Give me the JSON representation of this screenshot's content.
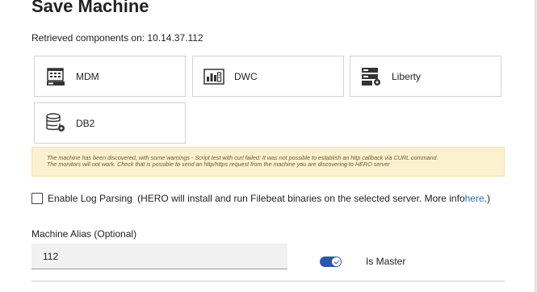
{
  "page": {
    "title": "Save Machine",
    "retrieved_text": "Retrieved components on: 10.14.37.112"
  },
  "components": [
    {
      "label": "MDM",
      "icon": "calendar-server-icon"
    },
    {
      "label": "DWC",
      "icon": "dashboard-chart-icon"
    },
    {
      "label": "Liberty",
      "icon": "server-gear-icon"
    },
    {
      "label": "DB2",
      "icon": "database-gear-icon"
    }
  ],
  "warning": {
    "line1": "The machine has been discovered, with some warnings - Script test with curl failed: It was not possible to establish an http callback via CURL command.",
    "line2": "The monitors will not work. Check that is possible to send an http/https request from the machine you are discovering to HERO server"
  },
  "log_parsing": {
    "label": "Enable Log Parsing",
    "note": "(HERO will install and run Filebeat binaries on the selected server. More info ",
    "link": "here",
    "note_end": ".)",
    "checked": false
  },
  "alias": {
    "label": "Machine Alias (Optional)",
    "value": "112"
  },
  "master": {
    "label": "Is Master",
    "enabled": true
  },
  "colors": {
    "accent": "#2b5aa5",
    "link": "#1f6fc7",
    "warning_bg": "#fcf1cf"
  }
}
